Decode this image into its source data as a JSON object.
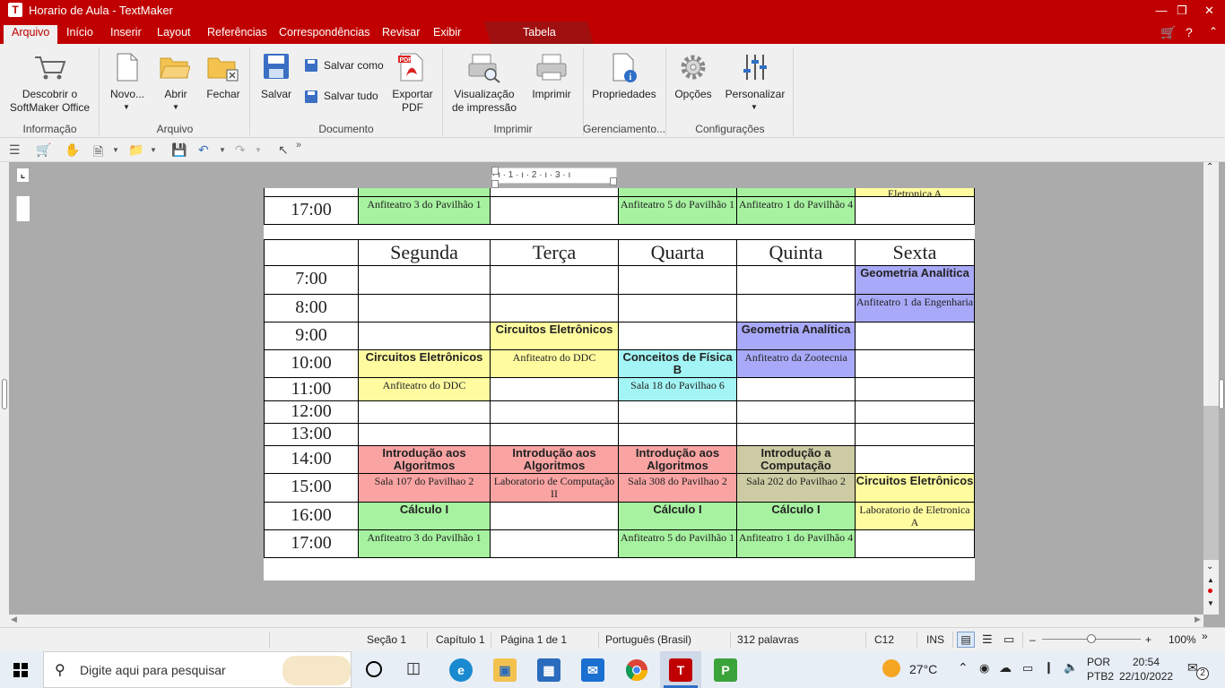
{
  "window": {
    "title": "Horario de Aula - TextMaker",
    "app_icon": "T"
  },
  "menu": {
    "tabs": [
      "Arquivo",
      "Início",
      "Inserir",
      "Layout",
      "Referências",
      "Correspondências",
      "Revisar",
      "Exibir"
    ],
    "context_tab": "Tabela"
  },
  "ribbon": {
    "discover": "Descobrir o\nSoftMaker Office",
    "novo": "Novo...",
    "abrir": "Abrir",
    "fechar": "Fechar",
    "salvar": "Salvar",
    "salvar_como": "Salvar como",
    "salvar_tudo": "Salvar tudo",
    "exportar_pdf": "Exportar\nPDF",
    "visualizacao": "Visualização\nde impressão",
    "imprimir": "Imprimir",
    "propriedades": "Propriedades",
    "opcoes": "Opções",
    "personalizar": "Personalizar",
    "groups": {
      "informacao": "Informação",
      "arquivo": "Arquivo",
      "documento": "Documento",
      "imprimir": "Imprimir",
      "gerenciamento": "Gerenciamento...",
      "configuracoes": "Configurações"
    }
  },
  "ruler": {
    "marks": "· ı · 1 · ı · 2 · ı · 3 · ı"
  },
  "document": {
    "top_fragment": {
      "prev_row_text": "Eletronica A",
      "time": "17:00",
      "cells": [
        {
          "room": "Anfiteatro 3 do Pavilhão 1",
          "color": "green"
        },
        {
          "room": "",
          "color": ""
        },
        {
          "room": "Anfiteatro 5 do Pavilhão 1",
          "color": "green"
        },
        {
          "room": "Anfiteatro 1 do Pavilhão 4",
          "color": "green"
        },
        {
          "room": "",
          "color": ""
        }
      ]
    },
    "days": [
      "Segunda",
      "Terça",
      "Quarta",
      "Quinta",
      "Sexta"
    ],
    "rows": [
      {
        "time": "7:00",
        "cells": [
          {},
          {},
          {},
          {},
          {
            "subj": "Geometria Analítica",
            "color": "blue"
          }
        ]
      },
      {
        "time": "8:00",
        "cells": [
          {},
          {},
          {},
          {},
          {
            "room": "Anfiteatro 1 da Engenharia",
            "color": "blue"
          }
        ]
      },
      {
        "time": "9:00",
        "cells": [
          {},
          {
            "subj": "Circuitos Eletrônicos",
            "color": "yellow"
          },
          {},
          {
            "subj": "Geometria Analítica",
            "color": "blue"
          },
          {}
        ]
      },
      {
        "time": "10:00",
        "cells": [
          {
            "subj": "Circuitos Eletrônicos",
            "color": "yellow"
          },
          {
            "room": "Anfiteatro do DDC",
            "color": "yellow"
          },
          {
            "subj": "Conceitos de Física B",
            "color": "cyan"
          },
          {
            "room": "Anfiteatro da Zootecnia",
            "color": "blue"
          },
          {}
        ]
      },
      {
        "time": "11:00",
        "cells": [
          {
            "room": "Anfiteatro do DDC",
            "color": "yellow"
          },
          {},
          {
            "room": "Sala 18 do Pavilhao 6",
            "color": "cyan"
          },
          {},
          {}
        ]
      },
      {
        "time": "12:00",
        "cells": [
          {},
          {},
          {},
          {},
          {}
        ]
      },
      {
        "time": "13:00",
        "cells": [
          {},
          {},
          {},
          {},
          {}
        ]
      },
      {
        "time": "14:00",
        "cells": [
          {
            "subj": "Introdução aos Algoritmos",
            "color": "pink"
          },
          {
            "subj": "Introdução aos Algoritmos",
            "color": "pink"
          },
          {
            "subj": "Introdução aos Algoritmos",
            "color": "pink"
          },
          {
            "subj": "Introdução a Computação",
            "color": "olive"
          },
          {}
        ]
      },
      {
        "time": "15:00",
        "cells": [
          {
            "room": "Sala 107 do Pavilhao 2",
            "color": "pink"
          },
          {
            "room": "Laboratorio de Computação II",
            "color": "pink"
          },
          {
            "room": "Sala 308 do Pavilhao 2",
            "color": "pink"
          },
          {
            "room": "Sala 202 do Pavilhao 2",
            "color": "olive"
          },
          {
            "subj": "Circuitos Eletrônicos",
            "color": "yellow"
          }
        ]
      },
      {
        "time": "16:00",
        "cells": [
          {
            "subj": "Cálculo I",
            "color": "green"
          },
          {},
          {
            "subj": "Cálculo I",
            "color": "green"
          },
          {
            "subj": "Cálculo I",
            "color": "green"
          },
          {
            "room": "Laboratorio de Eletronica A",
            "color": "yellow"
          }
        ]
      },
      {
        "time": "17:00",
        "cells": [
          {
            "room": "Anfiteatro 3 do Pavilhão 1",
            "color": "green"
          },
          {},
          {
            "room": "Anfiteatro 5 do Pavilhão 1",
            "color": "green"
          },
          {
            "room": "Anfiteatro 1 do Pavilhão 4",
            "color": "green"
          },
          {}
        ]
      }
    ]
  },
  "status": {
    "secao": "Seção 1",
    "capitulo": "Capítulo 1",
    "pagina": "Página 1 de 1",
    "idioma": "Português (Brasil)",
    "palavras": "312 palavras",
    "celula": "C12",
    "modo": "INS",
    "zoom": "100%",
    "zoom_level": 0.5
  },
  "taskbar": {
    "search_placeholder": "Digite aqui para pesquisar",
    "weather": "27°C",
    "lang_top": "POR",
    "lang_bottom": "PTB2",
    "time": "20:54",
    "date": "22/10/2022",
    "notifications": "2"
  },
  "colors": {
    "green": "#a6f2a0",
    "yellow": "#fffca0",
    "blue": "#a9a9f9",
    "cyan": "#a3f4f4",
    "pink": "#f9a3a3",
    "olive": "#cdcba3",
    "brand": "#c00000"
  }
}
